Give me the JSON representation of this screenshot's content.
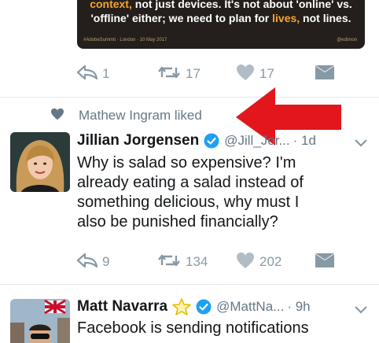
{
  "colors": {
    "accent": "#1da1f2",
    "muted": "#8899a6",
    "red_arrow": "#e3161c",
    "card_bg": "#241f1c",
    "highlight": "#f6a531"
  },
  "media_card": {
    "line1_hl": "context,",
    "line1_rest": " not just devices. It's not about 'online' vs.",
    "line2_pre": "'offline' either; we need to plan for ",
    "line2_hl": "lives,",
    "line2_post": " not lines.",
    "footer_left": "#AdobeSummit · London · 10 May 2017",
    "footer_right": "@edimon"
  },
  "tweet0": {
    "replies": "1",
    "retweets": "17",
    "likes": "17"
  },
  "liked_row": {
    "icon": "heart-icon",
    "text": "Mathew Ingram liked"
  },
  "tweet1": {
    "display_name": "Jillian Jorgensen",
    "handle": "@Jill_Jor...",
    "time": "· 1d",
    "text_lines": [
      "Why is salad so expensive?  I'm",
      "already eating a salad instead of",
      "something delicious, why must I",
      "also be punished financially?"
    ],
    "replies": "9",
    "retweets": "134",
    "likes": "202"
  },
  "tweet2": {
    "display_name": "Matt Navarra",
    "handle": "@MattNa...",
    "time": "· 9h",
    "text_lines": [
      "Facebook is sending notifications"
    ]
  }
}
